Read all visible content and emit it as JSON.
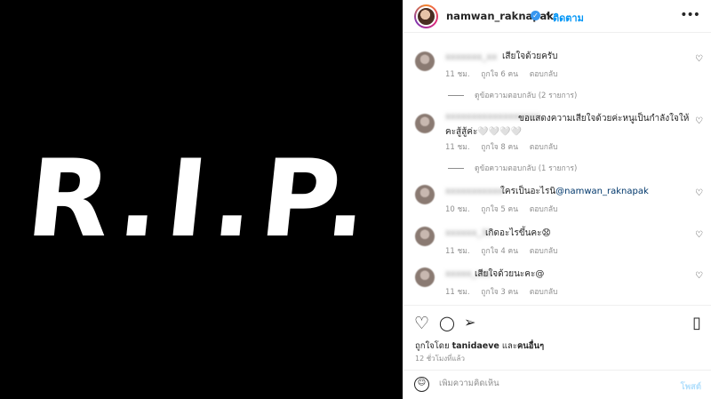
{
  "post_image": {
    "text": "R.I.P."
  },
  "header": {
    "username": "namwan_raknapak",
    "follow_label": "ติดตาม",
    "separator": "•",
    "verified_glyph": "✓",
    "more_glyph": "•••"
  },
  "comments": [
    {
      "username": "xxxxxxx_xx",
      "text": "เสียใจด้วยครับ",
      "time": "11 ชม.",
      "likes": "ถูกใจ 6 คน",
      "reply": "ตอบกลับ",
      "view_replies": "ดูข้อความตอบกลับ (2 รายการ)"
    },
    {
      "username": "xxxxxxxxxxxxxxxxxx",
      "text": "ขอแสดงความเสียใจด้วยค่ะหนูเป็นกำลังใจให้คะสู้สู้ค่ะ🤍🤍🤍🤍",
      "time": "11 ชม.",
      "likes": "ถูกใจ 8 คน",
      "reply": "ตอบกลับ",
      "view_replies": "ดูข้อความตอบกลับ (1 รายการ)"
    },
    {
      "username": "xxxxxxxxxxx",
      "text": "ใครเป็นอะไรนิ",
      "mention": "@namwan_raknapak",
      "time": "10 ชม.",
      "likes": "ถูกใจ 5 คน",
      "reply": "ตอบกลับ"
    },
    {
      "username": "xxxxxx_31",
      "text": "เกิดอะไรขึ้นคะ😧",
      "time": "11 ชม.",
      "likes": "ถูกใจ 4 คน",
      "reply": "ตอบกลับ"
    },
    {
      "username": "xxxxx_xxx",
      "text": "เสียใจด้วยนะคะ@",
      "time": "11 ชม.",
      "likes": "ถูกใจ 3 คน",
      "reply": "ตอบกลับ"
    }
  ],
  "actions": {
    "heart_glyph": "♡",
    "comment_glyph": "◯",
    "share_glyph": "➢",
    "bookmark_glyph": "▯"
  },
  "likes_line": {
    "prefix": "ถูกใจโดย",
    "user": "tanidaeve",
    "suffix_and": "และ",
    "others": "คนอื่นๆ"
  },
  "timeago": "12 ชั่วโมงที่แล้ว",
  "comment_box": {
    "placeholder": "เพิ่มความคิดเห็น",
    "post_label": "โพสต์",
    "emoji_glyph": "☺"
  }
}
